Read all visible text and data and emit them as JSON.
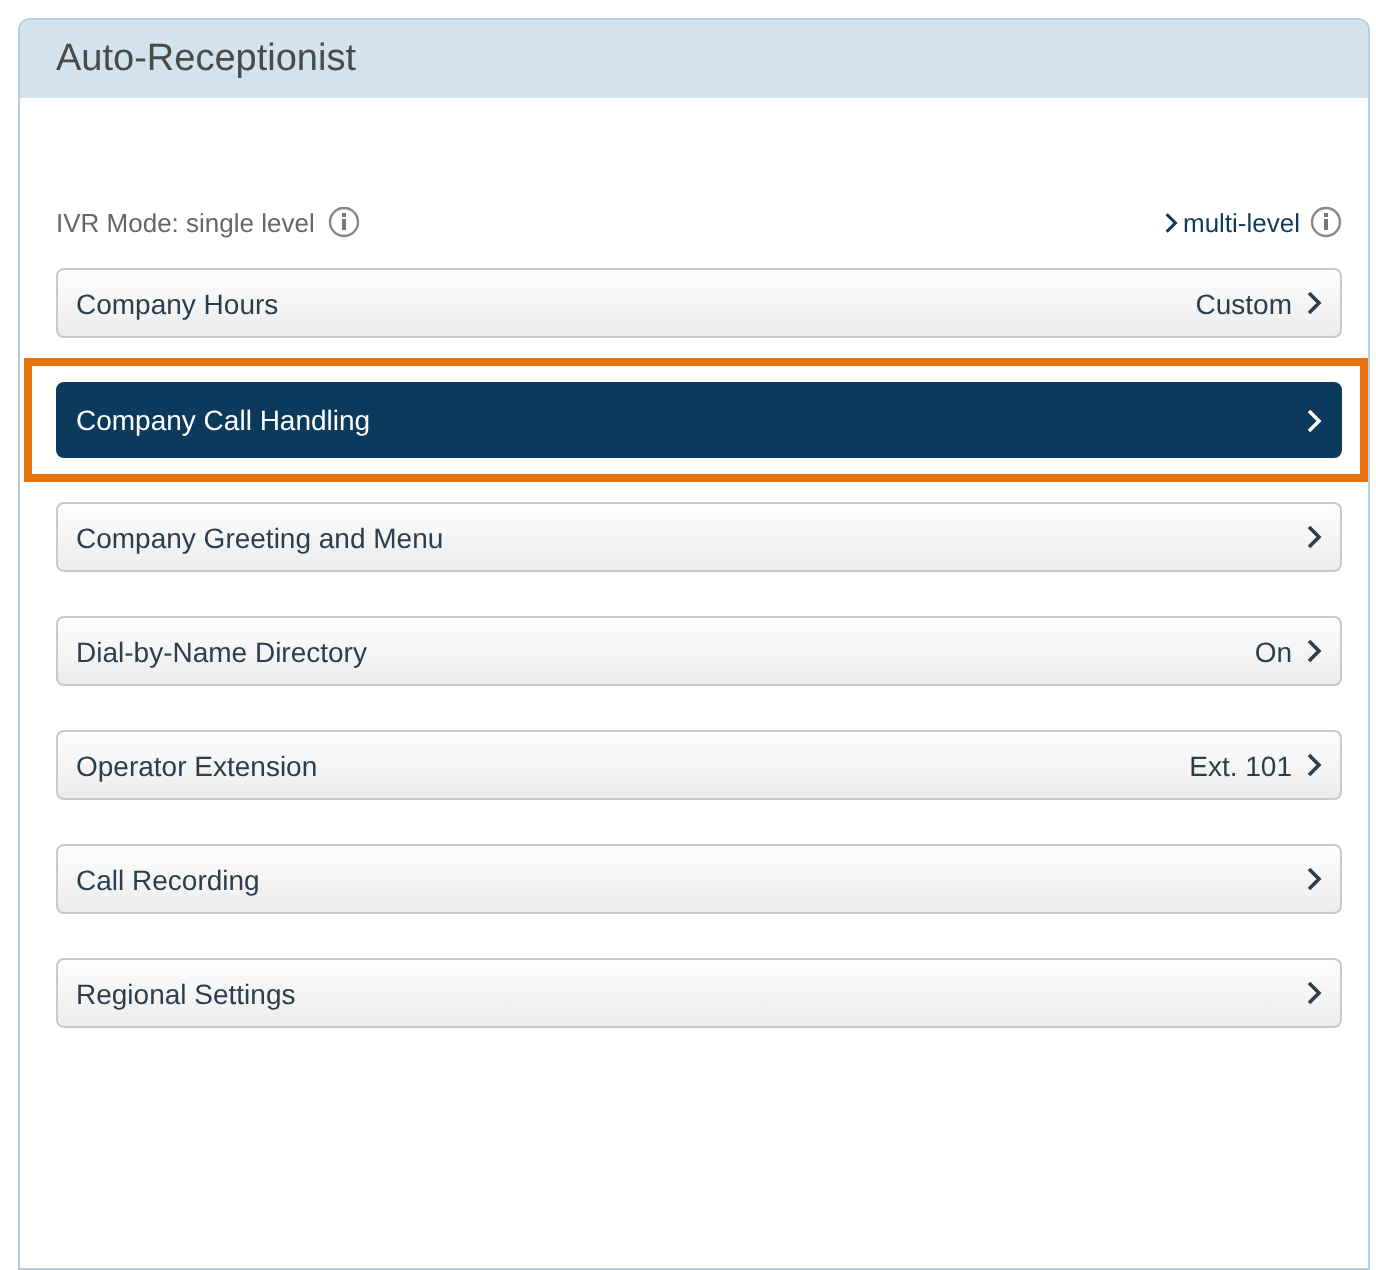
{
  "panel": {
    "title": "Auto-Receptionist"
  },
  "ivr_mode": {
    "label": "IVR Mode: single level",
    "link": "multi-level"
  },
  "items": [
    {
      "label": "Company Hours",
      "value": "Custom",
      "selected": false,
      "highlighted": false
    },
    {
      "label": "Company Call Handling",
      "selected": true,
      "highlighted": true
    },
    {
      "label": "Company Greeting and Menu",
      "selected": false,
      "highlighted": false
    },
    {
      "label": "Dial-by-Name Directory",
      "value": "On",
      "selected": false,
      "highlighted": false
    },
    {
      "label": "Operator Extension",
      "value": "Ext. 101",
      "selected": false,
      "highlighted": false
    },
    {
      "label": "Call Recording",
      "selected": false,
      "highlighted": false
    },
    {
      "label": "Regional Settings",
      "selected": false,
      "highlighted": false
    }
  ]
}
